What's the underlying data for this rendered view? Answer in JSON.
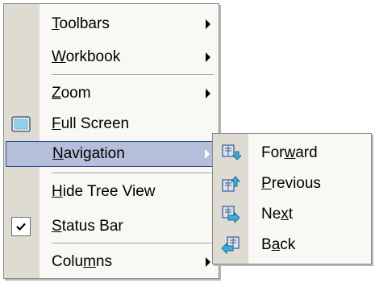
{
  "menu": {
    "items": [
      {
        "label_pre": "",
        "mnemonic": "T",
        "label_post": "oolbars",
        "submenu": true
      },
      {
        "label_pre": "",
        "mnemonic": "W",
        "label_post": "orkbook",
        "submenu": true
      },
      {
        "label_pre": "",
        "mnemonic": "Z",
        "label_post": "oom",
        "submenu": true
      },
      {
        "label_pre": "",
        "mnemonic": "F",
        "label_post": "ull Screen",
        "icon": "full-screen-icon"
      },
      {
        "label_pre": "",
        "mnemonic": "N",
        "label_post": "avigation",
        "submenu": true,
        "selected": true
      },
      {
        "label_pre": "",
        "mnemonic": "H",
        "label_post": "ide Tree View"
      },
      {
        "label_pre": "",
        "mnemonic": "S",
        "label_post": "tatus Bar",
        "checked": true
      },
      {
        "label_pre": "Colu",
        "mnemonic": "m",
        "label_post": "ns",
        "submenu": true
      }
    ]
  },
  "submenu": {
    "items": [
      {
        "label_pre": "For",
        "mnemonic": "w",
        "label_post": "ard",
        "icon": "forward-icon"
      },
      {
        "label_pre": "",
        "mnemonic": "P",
        "label_post": "revious",
        "icon": "previous-icon"
      },
      {
        "label_pre": "Ne",
        "mnemonic": "x",
        "label_post": "t",
        "icon": "next-icon"
      },
      {
        "label_pre": "B",
        "mnemonic": "a",
        "label_post": "ck",
        "icon": "back-icon"
      }
    ]
  },
  "colors": {
    "selection_bg": "#b5bfd9",
    "selection_border": "#2a4b9a",
    "gutter": "#dedbd3",
    "menu_bg": "#f9f8f4"
  }
}
